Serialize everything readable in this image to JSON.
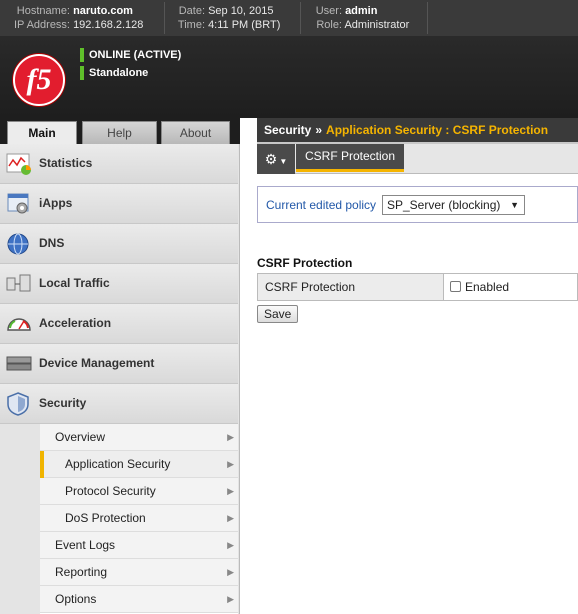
{
  "header": {
    "hostname_label": "Hostname:",
    "hostname": "naruto.com",
    "ip_label": "IP Address:",
    "ip": "192.168.2.128",
    "date_label": "Date:",
    "date": "Sep 10, 2015",
    "time_label": "Time:",
    "time": "4:11 PM (BRT)",
    "user_label": "User:",
    "user": "admin",
    "role_label": "Role:",
    "role": "Administrator"
  },
  "banner": {
    "logo_text": "f5",
    "status_online": "ONLINE (ACTIVE)",
    "status_mode": "Standalone",
    "status_color": "#5fbf2a"
  },
  "tabs": [
    {
      "label": "Main",
      "active": true
    },
    {
      "label": "Help",
      "active": false
    },
    {
      "label": "About",
      "active": false
    }
  ],
  "sidebar": {
    "items": [
      {
        "label": "Statistics",
        "icon": "statistics-icon"
      },
      {
        "label": "iApps",
        "icon": "iapps-icon"
      },
      {
        "label": "DNS",
        "icon": "dns-icon"
      },
      {
        "label": "Local Traffic",
        "icon": "local-traffic-icon"
      },
      {
        "label": "Acceleration",
        "icon": "acceleration-icon"
      },
      {
        "label": "Device Management",
        "icon": "device-management-icon"
      },
      {
        "label": "Security",
        "icon": "security-shield-icon"
      }
    ],
    "submenu": [
      {
        "label": "Overview"
      },
      {
        "label": "Application Security",
        "selected": true
      },
      {
        "label": "Protocol Security"
      },
      {
        "label": "DoS Protection"
      },
      {
        "label": "Event Logs"
      },
      {
        "label": "Reporting"
      },
      {
        "label": "Options"
      }
    ]
  },
  "breadcrumb": {
    "root": "Security",
    "separator": "»",
    "current": "Application Security : CSRF Protection"
  },
  "subnav": {
    "tab": "CSRF Protection"
  },
  "policy": {
    "label": "Current edited policy",
    "selected": "SP_Server (blocking)"
  },
  "csrf": {
    "section_title": "CSRF Protection",
    "row_label": "CSRF Protection",
    "checkbox_label": "Enabled",
    "checked": false
  },
  "save_label": "Save",
  "colors": {
    "accent": "#f5b400",
    "header_bg": "#3a3a3a",
    "link": "#2258a8"
  }
}
